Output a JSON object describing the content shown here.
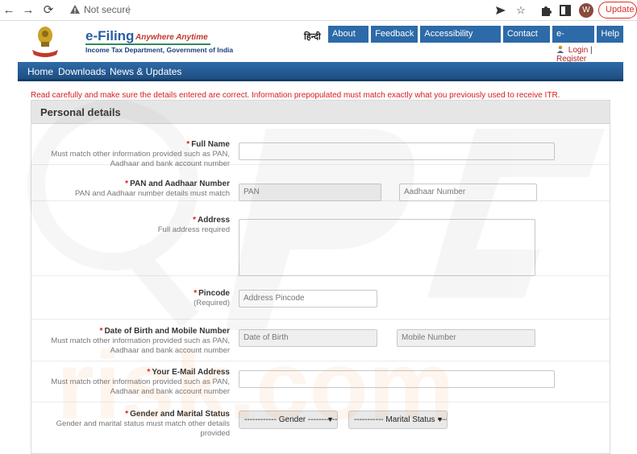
{
  "browser": {
    "back_icon": "←",
    "forward_icon": "→",
    "reload_icon": "⟳",
    "security_text": "Not secure",
    "avatar_letter": "W",
    "update_label": "Update"
  },
  "header": {
    "brand_title": "e-Filing",
    "brand_tagline": "Anywhere Anytime",
    "brand_subtitle": "Income Tax Department, Government of India",
    "hindi_link": "हिन्दी",
    "top_nav": [
      "About Us",
      "Feedback",
      "Accessibility Options",
      "Contact Us",
      "e-Nivaran",
      "Help"
    ],
    "login_label": "Login",
    "register_label": "Register",
    "login_separator": "|"
  },
  "main_nav": [
    "Home",
    "Downloads",
    "News & Updates"
  ],
  "notice": "Read carefully and make sure the details entered are correct. Information prepopulated must match exactly what you previously used to receive ITR.",
  "form": {
    "title": "Personal details",
    "fields": {
      "full_name": {
        "label": "Full Name",
        "hint": "Must match other information provided such as PAN, Aadhaar and bank account number",
        "value": ""
      },
      "pan_aadhaar": {
        "label": "PAN and Aadhaar Number",
        "hint": "PAN and Aadhaar number details must match",
        "pan_placeholder": "PAN",
        "aadhaar_placeholder": "Aadhaar Number"
      },
      "address": {
        "label": "Address",
        "hint": "Full address required"
      },
      "pincode": {
        "label": "Pincode",
        "hint": "(Required)",
        "placeholder": "Address Pincode"
      },
      "dob_mobile": {
        "label": "Date of Birth and Mobile Number",
        "hint": "Must match other information provided such as PAN, Aadhaar and bank account number",
        "dob_placeholder": "Date of Birth",
        "mobile_placeholder": "Mobile Number"
      },
      "email": {
        "label": "Your E-Mail Address",
        "hint": "Must match other information provided such as PAN, Aadhaar and bank account number"
      },
      "gender_marital": {
        "label": "Gender and Marital Status",
        "hint": "Gender and marital status must match other details provided",
        "gender_selected": "------------ Gender ------------",
        "marital_selected": "----------- Marital Status -----------"
      }
    },
    "required_mark": "*"
  },
  "colors": {
    "nav_blue": "#2d6aa8",
    "required_red": "#d81b1b",
    "brand_blue": "#2a5ea6"
  },
  "watermark_text": "risk.com"
}
